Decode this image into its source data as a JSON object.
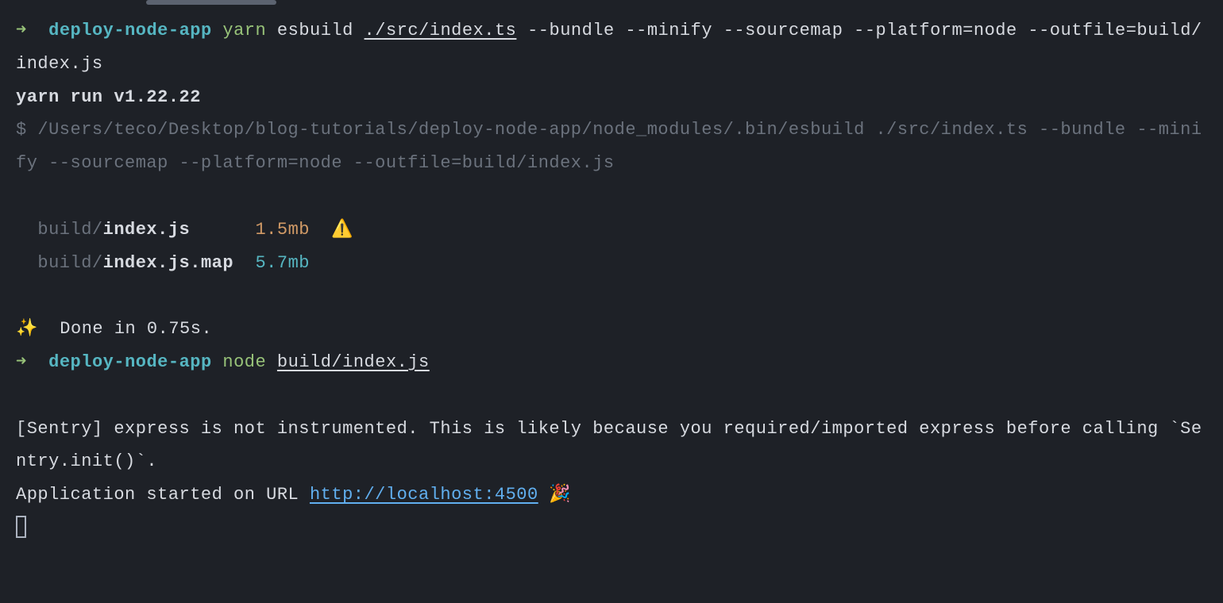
{
  "line1": {
    "arrow": "➜",
    "dir": "deploy-node-app",
    "cmd": "yarn",
    "tool": "esbuild",
    "entry": "./src/index.ts",
    "flags": " --bundle --minify --sourcemap --platform=node --outfile=build/index.js"
  },
  "line2": {
    "text": "yarn run v1.22.22"
  },
  "line3": {
    "prefix": "$ ",
    "path": "/Users/teco/Desktop/blog-tutorials/deploy-node-app/node_modules/.bin/esbuild ./src/index.ts --bundle --minify --sourcemap --platform=node --outfile=build/index.js"
  },
  "output1": {
    "prefix": "  build/",
    "file": "index.js",
    "spacer": "      ",
    "size": "1.5mb",
    "warn": "  ⚠️"
  },
  "output2": {
    "prefix": "  build/",
    "file": "index.js.map",
    "spacer": "  ",
    "size": "5.7mb"
  },
  "done": {
    "sparkle": "✨",
    "text": "  Done in 0.75s."
  },
  "line4": {
    "arrow": "➜",
    "dir": "deploy-node-app",
    "cmd": "node",
    "arg": "build/index.js"
  },
  "sentry": {
    "text": "[Sentry] express is not instrumented. This is likely because you required/imported express before calling `Sentry.init()`."
  },
  "app": {
    "prefix": "Application started on URL ",
    "url": "http://localhost:4500",
    "emoji": " 🎉"
  }
}
